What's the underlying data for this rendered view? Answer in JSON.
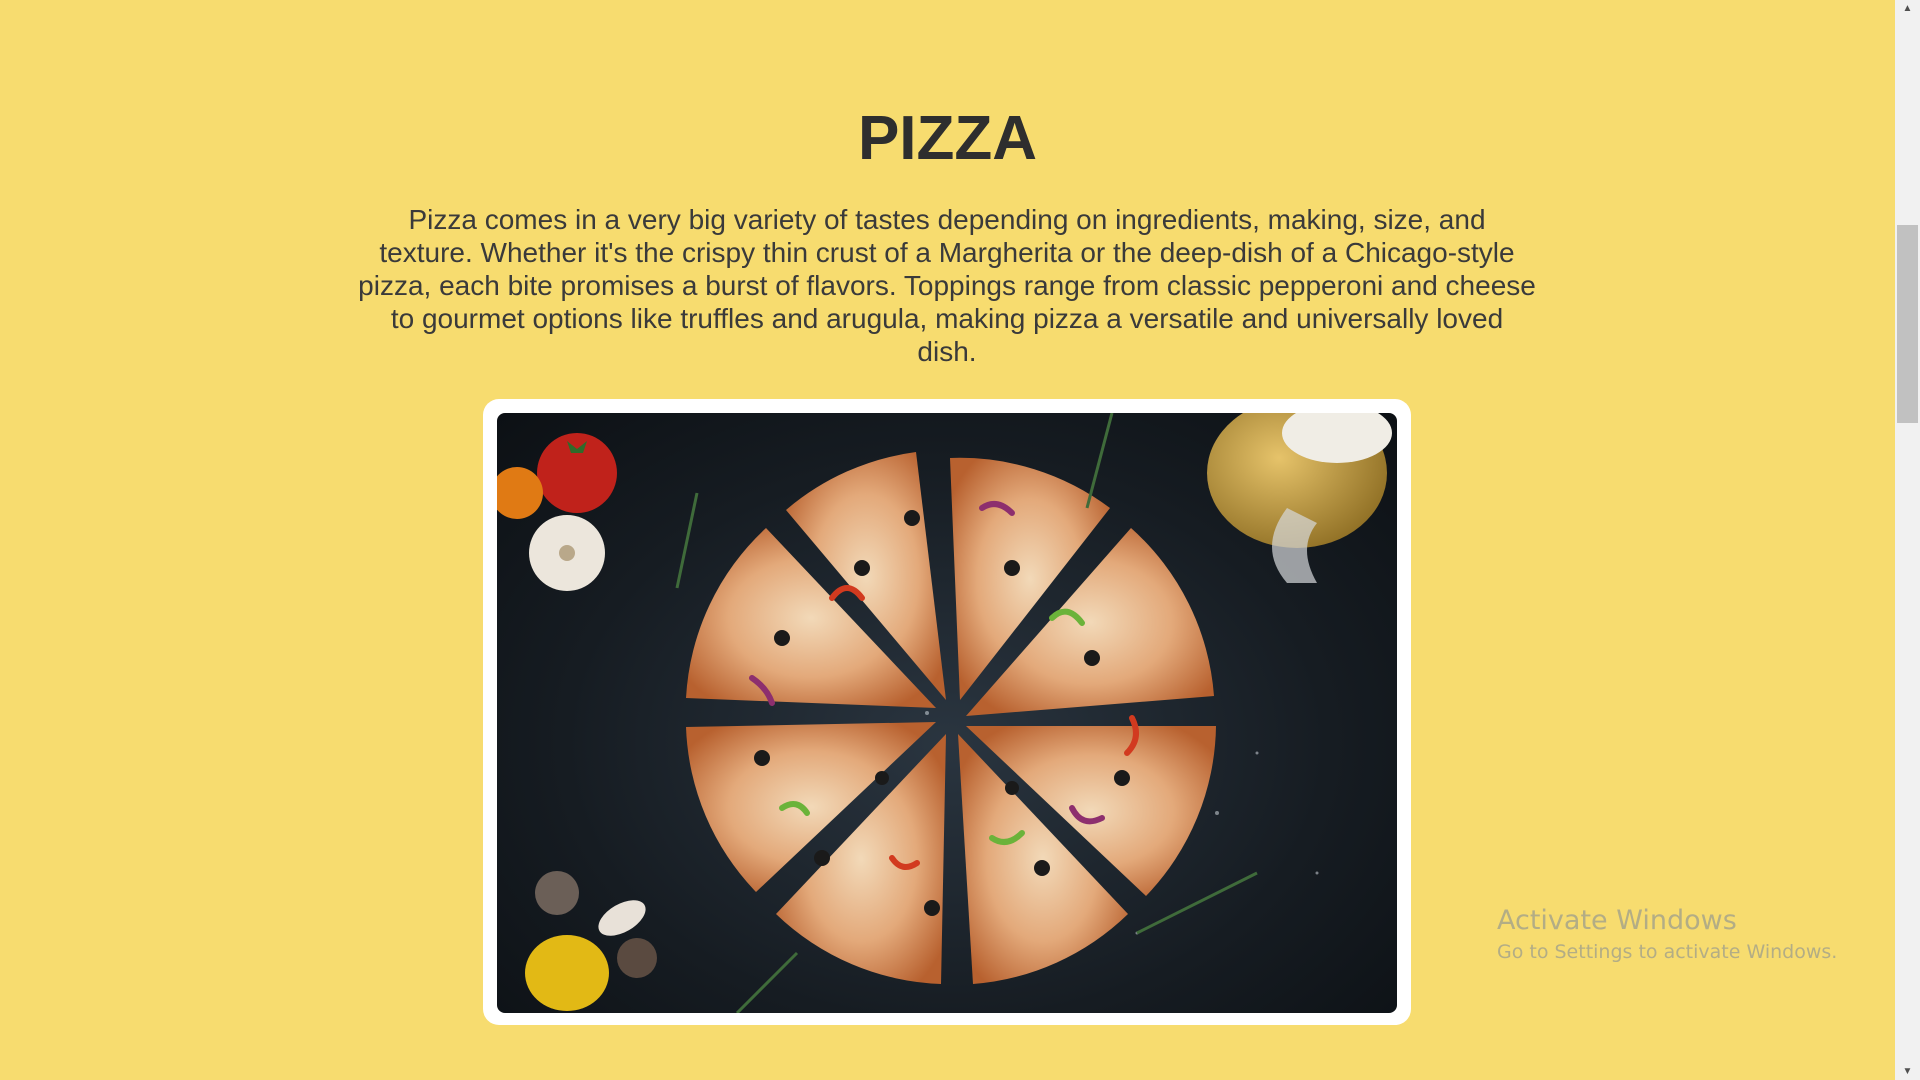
{
  "page": {
    "title": "PIZZA",
    "description": "Pizza comes in a very big variety of tastes depending on ingredients, making, size, and texture. Whether it's the crispy thin crust of a Margherita or the deep-dish of a Chicago-style pizza, each bite promises a burst of flavors. Toppings range from classic pepperoni and cheese to gourmet options like truffles and arugula, making pizza a versatile and universally loved dish."
  },
  "colors": {
    "background": "#f7dc6f",
    "title": "#2e2e2e",
    "frame": "#ffffff"
  },
  "watermark": {
    "title": "Activate Windows",
    "subtitle": "Go to Settings to activate Windows."
  },
  "scrollbar": {
    "up_icon": "arrow-up-icon",
    "down_icon": "arrow-down-icon"
  }
}
